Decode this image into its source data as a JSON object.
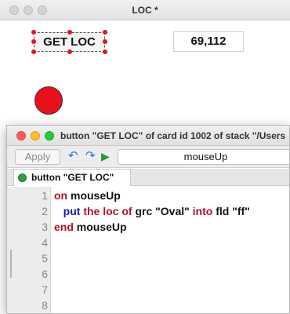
{
  "stack_window": {
    "title": "LOC *",
    "button_label": "GET LOC",
    "field_value": "69,112",
    "oval_color": "#e8111b"
  },
  "editor": {
    "title": "button \"GET LOC\" of card id 1002 of stack \"/Users",
    "apply_label": "Apply",
    "handler_selected": "mouseUp",
    "tab_label": "button \"GET LOC\"",
    "line_numbers": [
      "1",
      "2",
      "3",
      "4",
      "5",
      "6",
      "7",
      "8"
    ],
    "code": {
      "line1": {
        "kw1": "on",
        "rest": " mouseUp"
      },
      "line2": {
        "indent": "   ",
        "cmd": "put",
        "sp1": " ",
        "kw1": "the",
        "sp2": " ",
        "kw2": "loc",
        "sp3": " ",
        "kw3": "of",
        "sp4": " ",
        "t1": "grc",
        "sp5": " ",
        "s1": "\"Oval\"",
        "sp6": " ",
        "kw4": "into",
        "sp7": " ",
        "t2": "fld",
        "sp8": " ",
        "s2": "\"ff\""
      },
      "line3": {
        "kw1": "end",
        "rest": " mouseUp"
      }
    }
  }
}
